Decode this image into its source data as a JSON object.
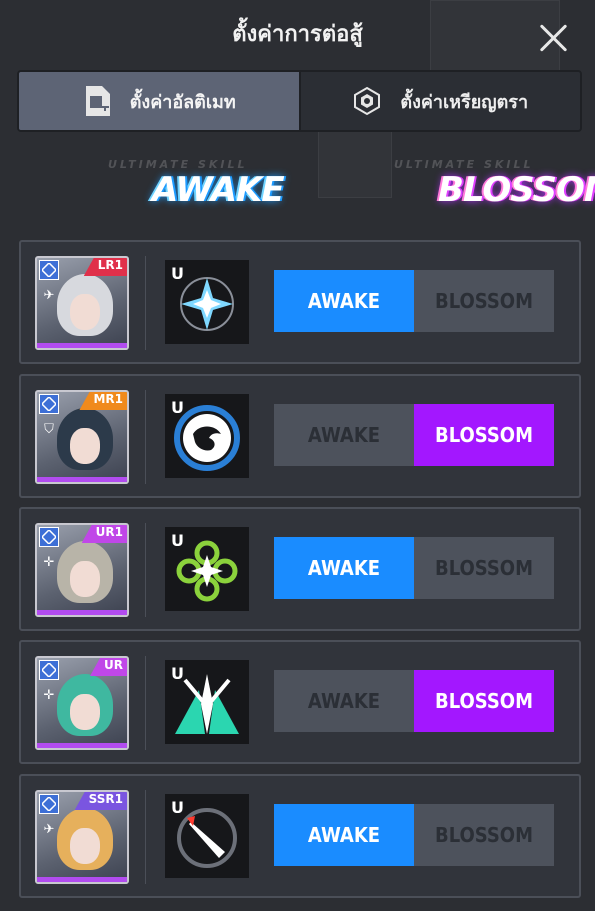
{
  "title": "ตั้งค่าการต่อสู้",
  "tabs": [
    {
      "label": "ตั้งค่าอัลติเมท",
      "icon": "sim-card-plus-icon",
      "active": true
    },
    {
      "label": "ตั้งค่าเหรียญตรา",
      "icon": "hexagon-badge-icon",
      "active": false
    }
  ],
  "modes": {
    "awake": {
      "caption": "ULTIMATE SKILL",
      "logo": "AWAKE"
    },
    "blossom": {
      "caption": "ULTIMATE SKILL",
      "logo": "BLOSSOM"
    }
  },
  "colors": {
    "awake_active": "#1a8cff",
    "blossom_active": "#a317ff",
    "button_inactive": "#4d525c",
    "rarity_bar": "#b24cf0"
  },
  "characters": [
    {
      "rank": "LR1",
      "rank_color": "#e0304a",
      "class_icon": "plane-icon",
      "hair": "#d7d9de",
      "skill_mark": "U",
      "skill_icon": "star-burst-icon",
      "awake_label": "AWAKE",
      "blossom_label": "BLOSSOM",
      "selected": "awake"
    },
    {
      "rank": "MR1",
      "rank_color": "#f08a1c",
      "class_icon": "shield-icon",
      "hair": "#2c3a4a",
      "skill_mark": "U",
      "skill_icon": "dragon-icon",
      "awake_label": "AWAKE",
      "blossom_label": "BLOSSOM",
      "selected": "blossom"
    },
    {
      "rank": "UR1",
      "rank_color": "#c047e8",
      "class_icon": "crosshair-icon",
      "hair": "#b8b4a8",
      "skill_mark": "U",
      "skill_icon": "clover-star-icon",
      "awake_label": "AWAKE",
      "blossom_label": "BLOSSOM",
      "selected": "awake"
    },
    {
      "rank": "UR",
      "rank_color": "#c047e8",
      "class_icon": "crosshair-icon",
      "hair": "#3fb8a0",
      "skill_mark": "U",
      "skill_icon": "burst-icon",
      "awake_label": "AWAKE",
      "blossom_label": "BLOSSOM",
      "selected": "blossom"
    },
    {
      "rank": "SSR1",
      "rank_color": "#7a55e0",
      "class_icon": "plane-icon",
      "hair": "#e6b05c",
      "skill_mark": "U",
      "skill_icon": "missile-target-icon",
      "awake_label": "AWAKE",
      "blossom_label": "BLOSSOM",
      "selected": "awake"
    }
  ]
}
